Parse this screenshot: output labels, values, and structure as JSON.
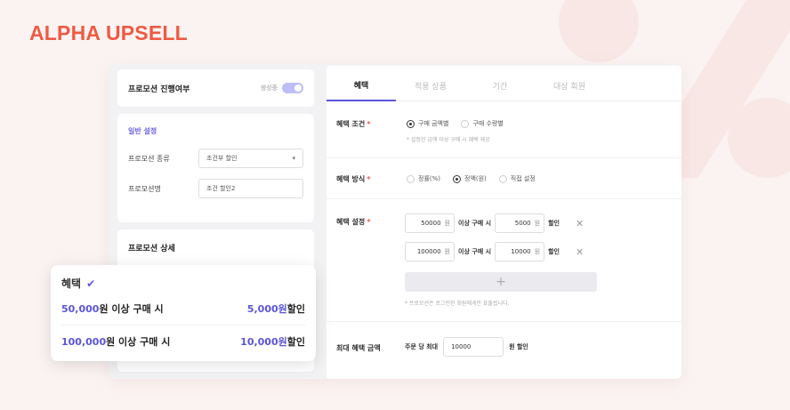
{
  "brand": "ALPHA UPSELL",
  "status_card": {
    "label": "프로모션 진행여부",
    "status": "생성중"
  },
  "general": {
    "title": "일반 설정",
    "type_label": "프로모션 종류",
    "type_value": "조건부 할인",
    "name_label": "프로모션명",
    "name_value": "조건 할인2"
  },
  "detail": {
    "title": "프로모션 상세"
  },
  "tabs": [
    "혜택",
    "적용 상품",
    "기간",
    "대상 회원"
  ],
  "condition": {
    "label": "혜택 조건",
    "options": [
      "구매 금액별",
      "구매 수량별"
    ],
    "hint": "* 설정한 금액 이상 구매 시 혜택 제공"
  },
  "method": {
    "label": "혜택 방식",
    "options": [
      "정률(%)",
      "정액(원)",
      "직접 설정"
    ]
  },
  "setting": {
    "label": "혜택 설정",
    "unit": "원",
    "mid_text": "이상 구매 시",
    "end_text": "할인",
    "rows": [
      {
        "amount": "50000",
        "discount": "5000"
      },
      {
        "amount": "100000",
        "discount": "10000"
      }
    ],
    "add": "+",
    "hint": "* 프로모션은 로그인한 회원에게만 표출됩니다."
  },
  "max": {
    "label": "최대 혜택 금액",
    "prefix": "주문 당 최대",
    "value": "10000",
    "suffix": "원 할인"
  },
  "float_card": {
    "title": "혜택",
    "rows": [
      {
        "amount": "50,000",
        "cond": "원 이상 구매 시",
        "discount": "5,000",
        "unit": "원",
        "end": "할인"
      },
      {
        "amount": "100,000",
        "cond": "원 이상 구매 시",
        "discount": "10,000",
        "unit": "원",
        "end": "할인"
      }
    ]
  },
  "colors": {
    "brand": "#ee5a43",
    "accent": "#5b54dc",
    "background": "#fbf3f2"
  }
}
